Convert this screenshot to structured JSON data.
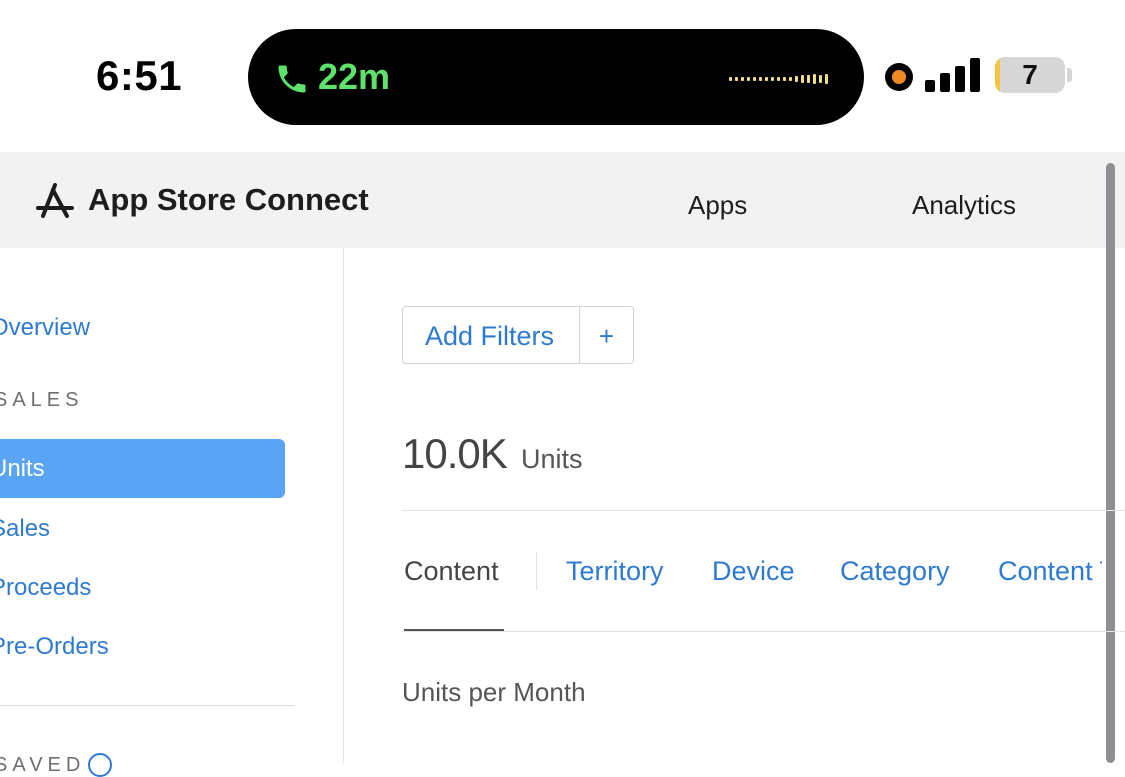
{
  "status_bar": {
    "time": "6:51",
    "call_duration": "22m",
    "battery_level": "7",
    "colors": {
      "call_green": "#5fe26a",
      "recording_orange": "#f08a24",
      "battery_yellow": "#f5c542"
    },
    "icons": [
      "phone-icon",
      "audio-wave-icon",
      "recording-indicator-icon",
      "cellular-signal-icon",
      "battery-icon"
    ]
  },
  "header": {
    "brand": "App Store Connect",
    "logo_icon": "app-store-icon",
    "nav": {
      "apps": "Apps",
      "analytics": "Analytics"
    }
  },
  "sidebar": {
    "overview": "Overview",
    "sales_section": "SALES",
    "items": [
      "Units",
      "Sales",
      "Proceeds",
      "Pre-Orders"
    ],
    "active_item": "Units",
    "saved_section": "SAVED",
    "saved_icon": "add-circle-icon"
  },
  "main": {
    "add_filters": "Add Filters",
    "add_filters_plus": "+",
    "total_value": "10.0K",
    "total_unit": "Units",
    "tabs": [
      "Content",
      "Territory",
      "Device",
      "Category",
      "Content Type"
    ],
    "active_tab": "Content",
    "chart_title": "Units per Month"
  },
  "colors": {
    "accent_blue": "#2f7ad1",
    "active_item_bg": "#5aa4f5",
    "nav_bg": "#f2f2f2"
  }
}
